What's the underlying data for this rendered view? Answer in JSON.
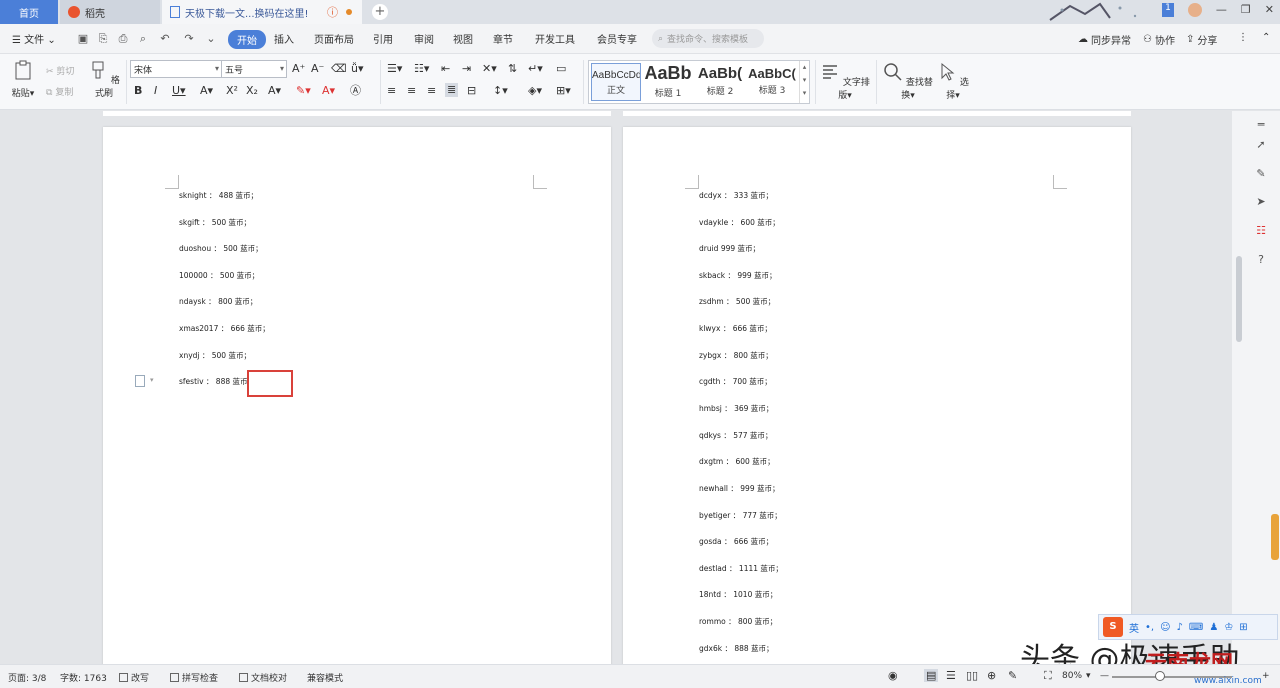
{
  "tabs": {
    "home": "首页",
    "daoke": "稻壳",
    "doc": "天极下载一文...换码在这里!",
    "new": "+"
  },
  "window": {
    "min": "—",
    "restore": "❐",
    "close": "✕",
    "badge": "1"
  },
  "menu": {
    "file": "文件",
    "items": [
      "开始",
      "插入",
      "页面布局",
      "引用",
      "审阅",
      "视图",
      "章节",
      "开发工具",
      "会员专享"
    ],
    "search_placeholder": "查找命令、搜索模板",
    "sync": "同步异常",
    "collab": "协作",
    "share": "分享"
  },
  "ribbon": {
    "paste": "粘贴",
    "cut": "剪切",
    "copy": "复制",
    "format_painter": "格式刷",
    "font_name": "宋体",
    "font_size": "五号",
    "styles": [
      {
        "sample": "AaBbCcDd",
        "label": "正文"
      },
      {
        "sample": "AaBb",
        "label": "标题 1"
      },
      {
        "sample": "AaBb(",
        "label": "标题 2"
      },
      {
        "sample": "AaBbC(",
        "label": "标题 3"
      }
    ],
    "text_layout": "文字排版",
    "find_replace": "查找替换",
    "select": "选择"
  },
  "document": {
    "left_lines": [
      "sknight ： 488 蓝币；",
      "skgift ： 500 蓝币；",
      "duoshou ： 500 蓝币；",
      "100000 ： 500 蓝币；",
      "ndaysk ： 800 蓝币；",
      "xmas2017 ： 666 蓝币；",
      "xnydj ： 500 蓝币；",
      "sfestiv ： 888 蓝币"
    ],
    "right_lines": [
      "dcdyx ： 333 蓝币；",
      "vdaykle ： 600 蓝币；",
      "druid 999 蓝币；",
      "skback ： 999 蓝币；",
      "zsdhm ： 500 蓝币；",
      "klwyx ： 666 蓝币；",
      "zybgx ： 800 蓝币；",
      "cgdth ： 700 蓝币；",
      "hmbsj ： 369 蓝币；",
      "qdkys ： 577 蓝币；",
      "dxgtm ： 600 蓝币；",
      "newhall ： 999 蓝币；",
      "byetiger ： 777 蓝币；",
      "gosda ： 666 蓝币；",
      "destlad ： 1111 蓝币；",
      "18ntd ： 1010 蓝币；",
      "rommo ： 800 蓝币；",
      "gdx6k ： 888 蓝币；"
    ]
  },
  "ime": {
    "logo": "S",
    "lang": "英"
  },
  "watermark": {
    "main": "头条 @极速手助",
    "overlay": "云南龙网",
    "url": "www.aixin.com"
  },
  "status": {
    "page": "页面: 3/8",
    "words": "字数: 1763",
    "revise": "改写",
    "spell": "拼写检查",
    "proof": "文档校对",
    "compat": "兼容模式",
    "zoom": "80%",
    "minus": "—",
    "plus": "+"
  },
  "colors": {
    "accent": "#4b7fd8",
    "highlight_box": "#d9413a",
    "ime_logo": "#f05a24"
  }
}
